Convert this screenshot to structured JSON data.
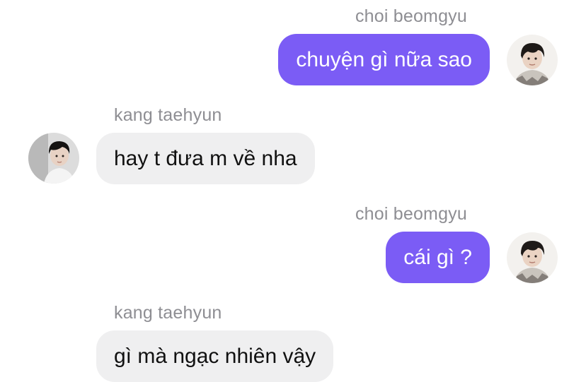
{
  "messages": [
    {
      "sender": "choi beomgyu",
      "text": "chuyện gì nữa sao",
      "direction": "outgoing",
      "avatar_icon": "user-avatar-beomgyu"
    },
    {
      "sender": "kang taehyun",
      "text": "hay t đưa m về nha",
      "direction": "incoming",
      "avatar_icon": "user-avatar-taehyun"
    },
    {
      "sender": "choi beomgyu",
      "text": "cái gì ?",
      "direction": "outgoing",
      "avatar_icon": "user-avatar-beomgyu"
    },
    {
      "sender": "kang taehyun",
      "text": "gì mà ngạc nhiên vậy",
      "direction": "incoming",
      "avatar_icon": "user-avatar-taehyun"
    }
  ],
  "colors": {
    "outgoing_bubble": "#7b5cf5",
    "incoming_bubble": "#efeff0",
    "sender_name": "#8e8e93"
  }
}
